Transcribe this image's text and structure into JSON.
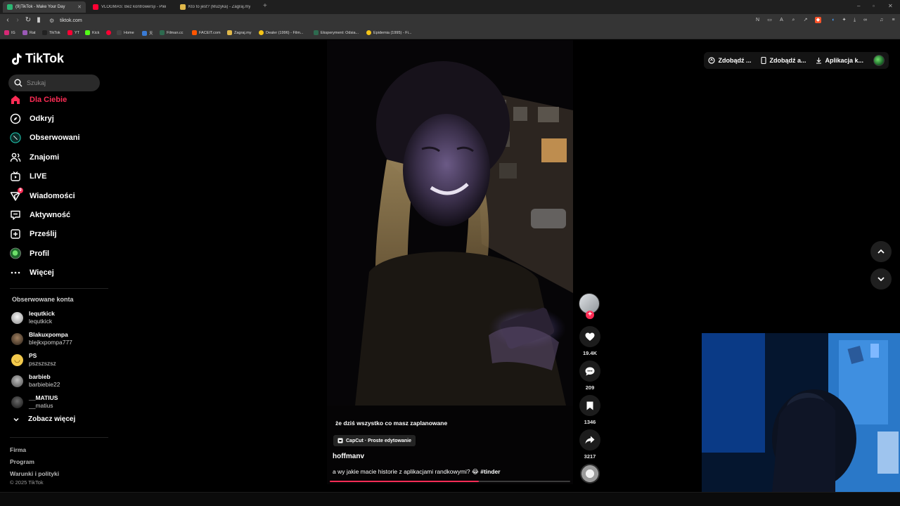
{
  "browser": {
    "tabs": [
      {
        "title": "(9)TikTok - Make Your Day",
        "active": true,
        "favicon_color": "#2bb673"
      },
      {
        "title": "VLOGMAS: Bez kontrowersji - Plemo",
        "active": false,
        "favicon_color": "#ff0033"
      },
      {
        "title": "Kto to jest? (Muzyka) - Zagraj.my",
        "active": false,
        "favicon_color": "#e0b84a"
      }
    ],
    "url": "tiktok.com",
    "bookmarks": [
      {
        "label": "IG",
        "color": "#d62976"
      },
      {
        "label": "Rat",
        "color": "#9b59b6"
      },
      {
        "label": "TikTok",
        "color": "#222222"
      },
      {
        "label": "YT",
        "color": "#ff0033"
      },
      {
        "label": "Kick",
        "color": "#53fc18"
      },
      {
        "label": "",
        "color": "#ff0033"
      },
      {
        "label": "Home",
        "color": "#444444"
      },
      {
        "label": "天",
        "color": "#3a7bd5"
      },
      {
        "label": "Filman.cc",
        "color": "#2d6a4f"
      },
      {
        "label": "FACEIT.com",
        "color": "#ff5500"
      },
      {
        "label": "Zagraj.my",
        "color": "#e0b84a"
      },
      {
        "label": "Dealer (1996) - Film...",
        "color": "#f5c518"
      },
      {
        "label": "Eksperyment: Odsia...",
        "color": "#2d6a4f"
      },
      {
        "label": "Epidemia (1995) - Fi...",
        "color": "#f5c518"
      }
    ]
  },
  "tiktok": {
    "logo": "TikTok",
    "search_placeholder": "Szukaj",
    "nav": [
      {
        "label": "Dla Ciebie",
        "icon": "home-icon",
        "active": true
      },
      {
        "label": "Odkryj",
        "icon": "compass-icon"
      },
      {
        "label": "Obserwowani",
        "icon": "following-icon"
      },
      {
        "label": "Znajomi",
        "icon": "friends-icon"
      },
      {
        "label": "LIVE",
        "icon": "live-icon"
      },
      {
        "label": "Wiadomości",
        "icon": "messages-icon",
        "badge": "9"
      },
      {
        "label": "Aktywność",
        "icon": "activity-icon"
      },
      {
        "label": "Prześlij",
        "icon": "upload-icon"
      },
      {
        "label": "Profil",
        "icon": "profile-icon"
      },
      {
        "label": "Więcej",
        "icon": "more-icon"
      }
    ],
    "following_title": "Obserwowane konta",
    "accounts": [
      {
        "name": "lequtkick",
        "handle": "lequtkick",
        "color": "#d8d8d8"
      },
      {
        "name": "Blakuxpompa",
        "handle": "blejkxpompa777",
        "color": "#5a4a3a"
      },
      {
        "name": "PS",
        "handle": "pszszszsz",
        "color": "#f2c94c"
      },
      {
        "name": "barbieb",
        "handle": "barbiebie22",
        "color": "#7a7a7a"
      },
      {
        "name": "__MATIUS",
        "handle": "__matius",
        "color": "#3a3a3a"
      }
    ],
    "see_more": "Zobacz więcej",
    "footer": [
      "Firma",
      "Program",
      "Warunki i polityki"
    ],
    "copyright": "© 2025 TikTok",
    "top_actions": [
      {
        "label": "Zdobądź ...",
        "icon": "coin-icon"
      },
      {
        "label": "Zdobądź a...",
        "icon": "phone-icon"
      },
      {
        "label": "Aplikacja k...",
        "icon": "download-icon"
      }
    ],
    "video": {
      "overlay_text": "że dziś wszystko co masz zaplanowane",
      "capcut": "CapCut · Proste edytowanie",
      "author": "hoffmanv",
      "description": "a wy jakie macie historie z aplikacjami randkowymi? 😂",
      "hashtag": "#tinder",
      "progress": 0.62
    },
    "stats": {
      "likes": "19.4K",
      "comments": "209",
      "saves": "1346",
      "shares": "3217"
    }
  }
}
